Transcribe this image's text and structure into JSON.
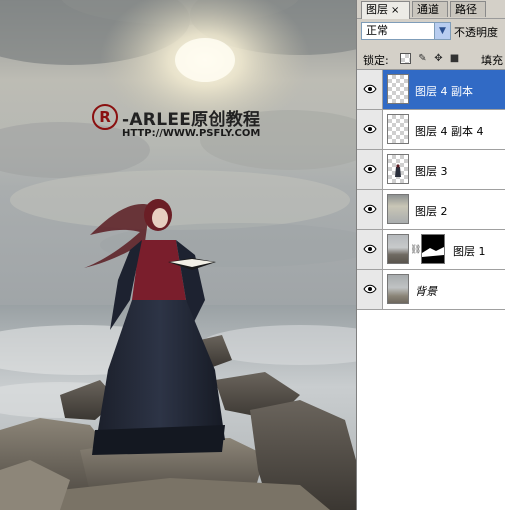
{
  "canvas": {
    "watermark_logo": "R",
    "watermark_title": "-ARLEE原创教程",
    "watermark_url": "HTTP://WWW.PSFLY.COM"
  },
  "panel": {
    "tabs": [
      {
        "label": "图层",
        "active": true,
        "close": "×"
      },
      {
        "label": "通道",
        "active": false
      },
      {
        "label": "路径",
        "active": false
      }
    ],
    "blend_mode": "正常",
    "opacity_label": "不透明度",
    "lock_label": "锁定:",
    "fill_label": "填充",
    "layers": [
      {
        "name": "图层 4 副本",
        "selected": true,
        "visible": true,
        "thumb": "transparent"
      },
      {
        "name": "图层 4 副本 4",
        "selected": false,
        "visible": true,
        "thumb": "transparent"
      },
      {
        "name": "图层 3",
        "selected": false,
        "visible": true,
        "thumb": "figure"
      },
      {
        "name": "图层 2",
        "selected": false,
        "visible": true,
        "thumb": "sky"
      },
      {
        "name": "图层 1",
        "selected": false,
        "visible": true,
        "thumb": "sea-with-mask"
      },
      {
        "name": "背景",
        "selected": false,
        "visible": true,
        "thumb": "background"
      }
    ]
  },
  "colors": {
    "selection": "#316ac5",
    "watermark_red": "#8a1010",
    "panel_bg": "#d4d0c8"
  }
}
